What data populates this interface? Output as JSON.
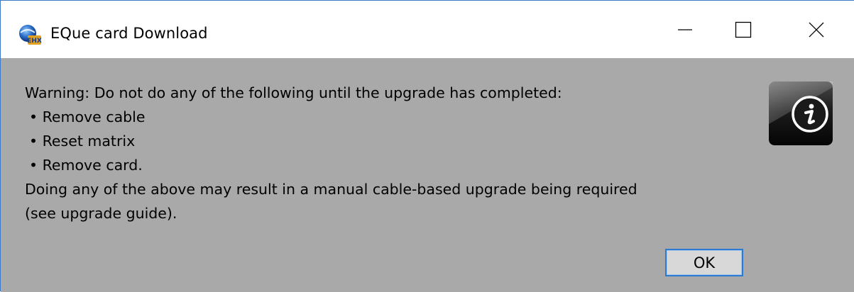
{
  "window": {
    "title": "EQue card Download",
    "app_icon": "eque-app-icon",
    "controls": {
      "minimize_icon": "minimize-icon",
      "maximize_icon": "maximize-icon",
      "close_icon": "close-icon"
    }
  },
  "dialog": {
    "message": {
      "warning": "Warning: Do not do any of the following until the upgrade has completed:",
      "bullets": [
        "• Remove cable",
        "• Reset matrix",
        "• Remove card."
      ],
      "consequence_line1": "Doing any of the above may result in a manual cable-based upgrade being required",
      "consequence_line2": "(see upgrade guide)."
    },
    "icon": "info-icon",
    "ok_label": "OK"
  },
  "colors": {
    "dialog_background": "#a9a9a9",
    "titlebar_background": "#ffffff",
    "window_border": "#3c78c4",
    "button_focus_border": "#2d7bd1"
  }
}
